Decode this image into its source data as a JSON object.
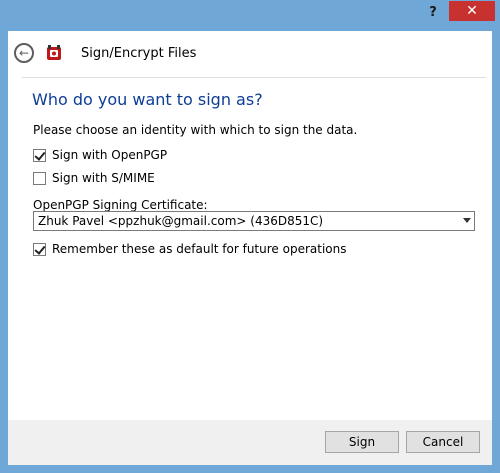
{
  "window": {
    "help_label": "?",
    "close_label": "✕"
  },
  "header": {
    "back_icon": "arrow-left-icon",
    "app_icon": "kleopatra-icon",
    "title": "Sign/Encrypt Files"
  },
  "main": {
    "heading": "Who do you want to sign as?",
    "prompt": "Please choose an identity with which to sign the data.",
    "sign_openpgp": {
      "label": "Sign with OpenPGP",
      "checked": true
    },
    "sign_smime": {
      "label": "Sign with S/MIME",
      "checked": false
    },
    "cert_label": "OpenPGP Signing Certificate:",
    "cert_selected": "Zhuk Pavel <ppzhuk@gmail.com> (436D851C)",
    "remember": {
      "label": "Remember these as default for future operations",
      "checked": true
    }
  },
  "footer": {
    "sign_label": "Sign",
    "cancel_label": "Cancel"
  },
  "colors": {
    "frame": "#6fa7d7",
    "heading": "#0e3d95",
    "close": "#c7312f"
  }
}
